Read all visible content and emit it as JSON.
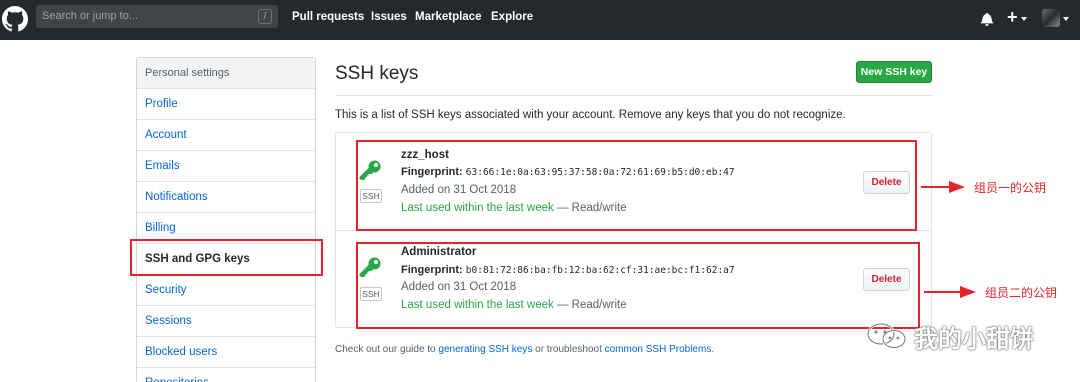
{
  "header": {
    "search_placeholder": "Search or jump to...",
    "search_shortcut": "/",
    "nav": [
      "Pull requests",
      "Issues",
      "Marketplace",
      "Explore"
    ],
    "plus_label": "+"
  },
  "sidebar": {
    "heading": "Personal settings",
    "items": [
      {
        "label": "Profile"
      },
      {
        "label": "Account"
      },
      {
        "label": "Emails"
      },
      {
        "label": "Notifications"
      },
      {
        "label": "Billing"
      },
      {
        "label": "SSH and GPG keys",
        "selected": true
      },
      {
        "label": "Security"
      },
      {
        "label": "Sessions"
      },
      {
        "label": "Blocked users"
      },
      {
        "label": "Repositories"
      }
    ]
  },
  "main": {
    "title": "SSH keys",
    "new_button": "New SSH key",
    "intro": "This is a list of SSH keys associated with your account. Remove any keys that you do not recognize.",
    "keys": [
      {
        "name": "zzz_host",
        "fingerprint_label": "Fingerprint:",
        "fingerprint": "63:66:1e:0a:63:95:37:58:0a:72:61:69:b5:d0:eb:47",
        "added": "Added on 31 Oct 2018",
        "last_used": "Last used within the last week",
        "access": " — Read/write",
        "badge": "SSH",
        "delete_label": "Delete",
        "annotation": "组员一的公钥"
      },
      {
        "name": "Administrator",
        "fingerprint_label": "Fingerprint:",
        "fingerprint": "b0:81:72:86:ba:fb:12:ba:62:cf:31:ae:bc:f1:62:a7",
        "added": "Added on 31 Oct 2018",
        "last_used": "Last used within the last week",
        "access": " — Read/write",
        "badge": "SSH",
        "delete_label": "Delete",
        "annotation": "组员二的公钥"
      }
    ],
    "footer": {
      "prefix": "Check out our guide to ",
      "link1": "generating SSH keys",
      "middle": " or troubleshoot ",
      "link2": "common SSH Problems",
      "suffix": "."
    }
  },
  "watermark": {
    "text": "我的小甜饼"
  },
  "colors": {
    "header_bg": "#24292e",
    "link": "#0366d6",
    "green": "#28a745",
    "danger": "#cb2431",
    "annotation_red": "#e3242b"
  }
}
